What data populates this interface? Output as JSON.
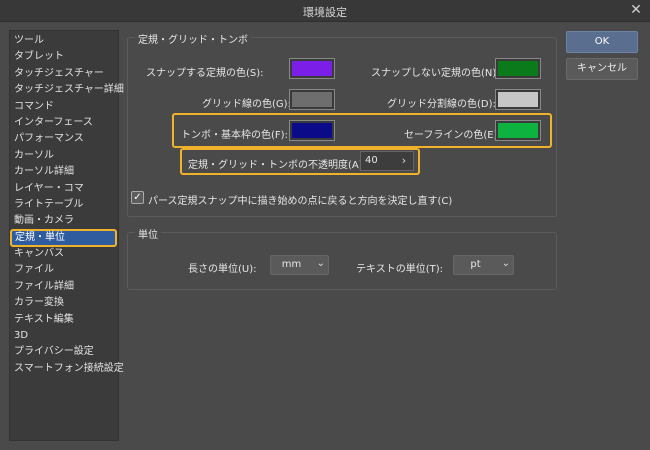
{
  "window": {
    "title": "環境設定",
    "close_glyph": "✕"
  },
  "sidebar": {
    "items": [
      {
        "label": "ツール"
      },
      {
        "label": "タブレット"
      },
      {
        "label": "タッチジェスチャー"
      },
      {
        "label": "タッチジェスチャー詳細"
      },
      {
        "label": "コマンド"
      },
      {
        "label": "インターフェース"
      },
      {
        "label": "パフォーマンス"
      },
      {
        "label": "カーソル"
      },
      {
        "label": "カーソル詳細"
      },
      {
        "label": "レイヤー・コマ"
      },
      {
        "label": "ライトテーブル"
      },
      {
        "label": "動画・カメラ"
      },
      {
        "label": "定規・単位"
      },
      {
        "label": "キャンバス"
      },
      {
        "label": "ファイル"
      },
      {
        "label": "ファイル詳細"
      },
      {
        "label": "カラー変換"
      },
      {
        "label": "テキスト編集"
      },
      {
        "label": "3D"
      },
      {
        "label": "プライバシー設定"
      },
      {
        "label": "スマートフォン接続設定"
      }
    ],
    "selected_index": 12
  },
  "ruler_section": {
    "title": "定規・グリッド・トンボ",
    "snap_ruler_color_label": "スナップする定規の色(S):",
    "snap_ruler_color": "#7b1fe8",
    "nosnap_ruler_color_label": "スナップしない定規の色(N):",
    "nosnap_ruler_color": "#0a7a1a",
    "grid_color_label": "グリッド線の色(G):",
    "grid_color": "#6e6e6e",
    "grid_div_color_label": "グリッド分割線の色(D):",
    "grid_div_color": "#c6c6c6",
    "crop_color_label": "トンボ・基本枠の色(F):",
    "crop_color": "#0b0b8a",
    "safe_line_color_label": "セーフラインの色(E):",
    "safe_line_color": "#0eb33f",
    "opacity_label": "定規・グリッド・トンボの不透明度(A):",
    "opacity_value": "40",
    "perspective_checkbox_label": "パース定規スナップ中に描き始めの点に戻ると方向を決定し直す(C)",
    "perspective_checked": true
  },
  "units_section": {
    "title": "単位",
    "length_label": "長さの単位(U):",
    "length_value": "mm",
    "text_label": "テキストの単位(T):",
    "text_value": "pt"
  },
  "buttons": {
    "ok": "OK",
    "cancel": "キャンセル"
  },
  "icons": {
    "close": "close-icon",
    "check": "checkmark-icon",
    "chevron_right": "chevron-right-icon",
    "chevron_down": "chevron-down-icon"
  },
  "colors": {
    "highlight": "#f0b22b",
    "selected": "#2e5c9e"
  }
}
